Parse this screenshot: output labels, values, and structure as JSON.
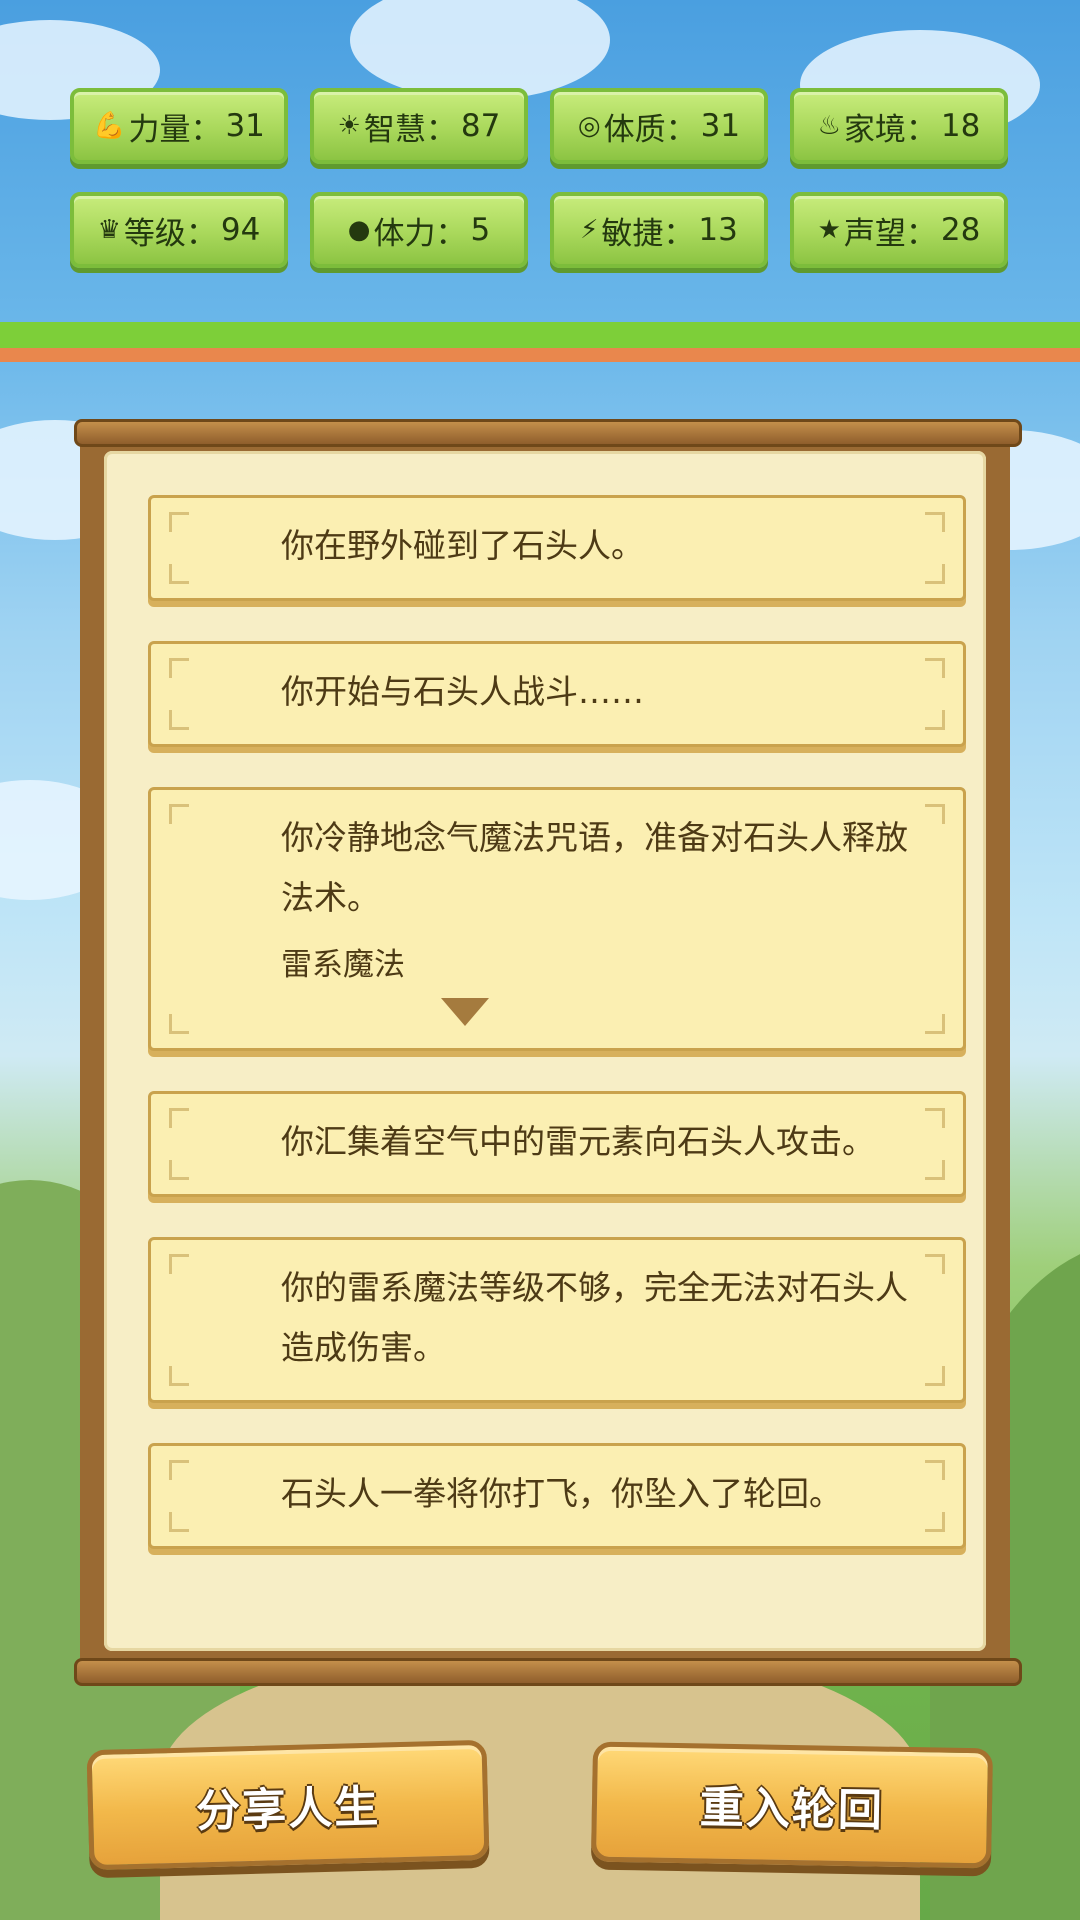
{
  "stats": [
    {
      "icon": "strength-icon",
      "glyph": "💪",
      "label": "力量",
      "value": "31"
    },
    {
      "icon": "wisdom-icon",
      "glyph": "☀",
      "label": "智慧",
      "value": "87"
    },
    {
      "icon": "constitution-icon",
      "glyph": "◎",
      "label": "体质",
      "value": "31"
    },
    {
      "icon": "family-icon",
      "glyph": "♨",
      "label": "家境",
      "value": "18"
    },
    {
      "icon": "crown-icon",
      "glyph": "♛",
      "label": "等级",
      "value": "94"
    },
    {
      "icon": "heart-icon",
      "glyph": "●",
      "label": "体力",
      "value": "5"
    },
    {
      "icon": "lightning-icon",
      "glyph": "⚡",
      "label": "敏捷",
      "value": "13"
    },
    {
      "icon": "star-icon",
      "glyph": "★",
      "label": "声望",
      "value": "28"
    }
  ],
  "events": [
    {
      "text": "你在野外碰到了石头人。"
    },
    {
      "text": "你开始与石头人战斗……"
    },
    {
      "text": "你冷静地念气魔法咒语，准备对石头人释放法术。",
      "choice": "雷系魔法"
    },
    {
      "text": "你汇集着空气中的雷元素向石头人攻击。"
    },
    {
      "text": "你的雷系魔法等级不够，完全无法对石头人造成伤害。"
    },
    {
      "text": "石头人一拳将你打飞，你坠入了轮回。"
    }
  ],
  "buttons": {
    "share": "分享人生",
    "restart": "重入轮回"
  },
  "colors": {
    "stat_green": "#a9d85b",
    "paper": "#f7eec6",
    "card": "#fbefb2",
    "button_gold": "#f2b84a",
    "text_brown": "#4d3a15"
  }
}
